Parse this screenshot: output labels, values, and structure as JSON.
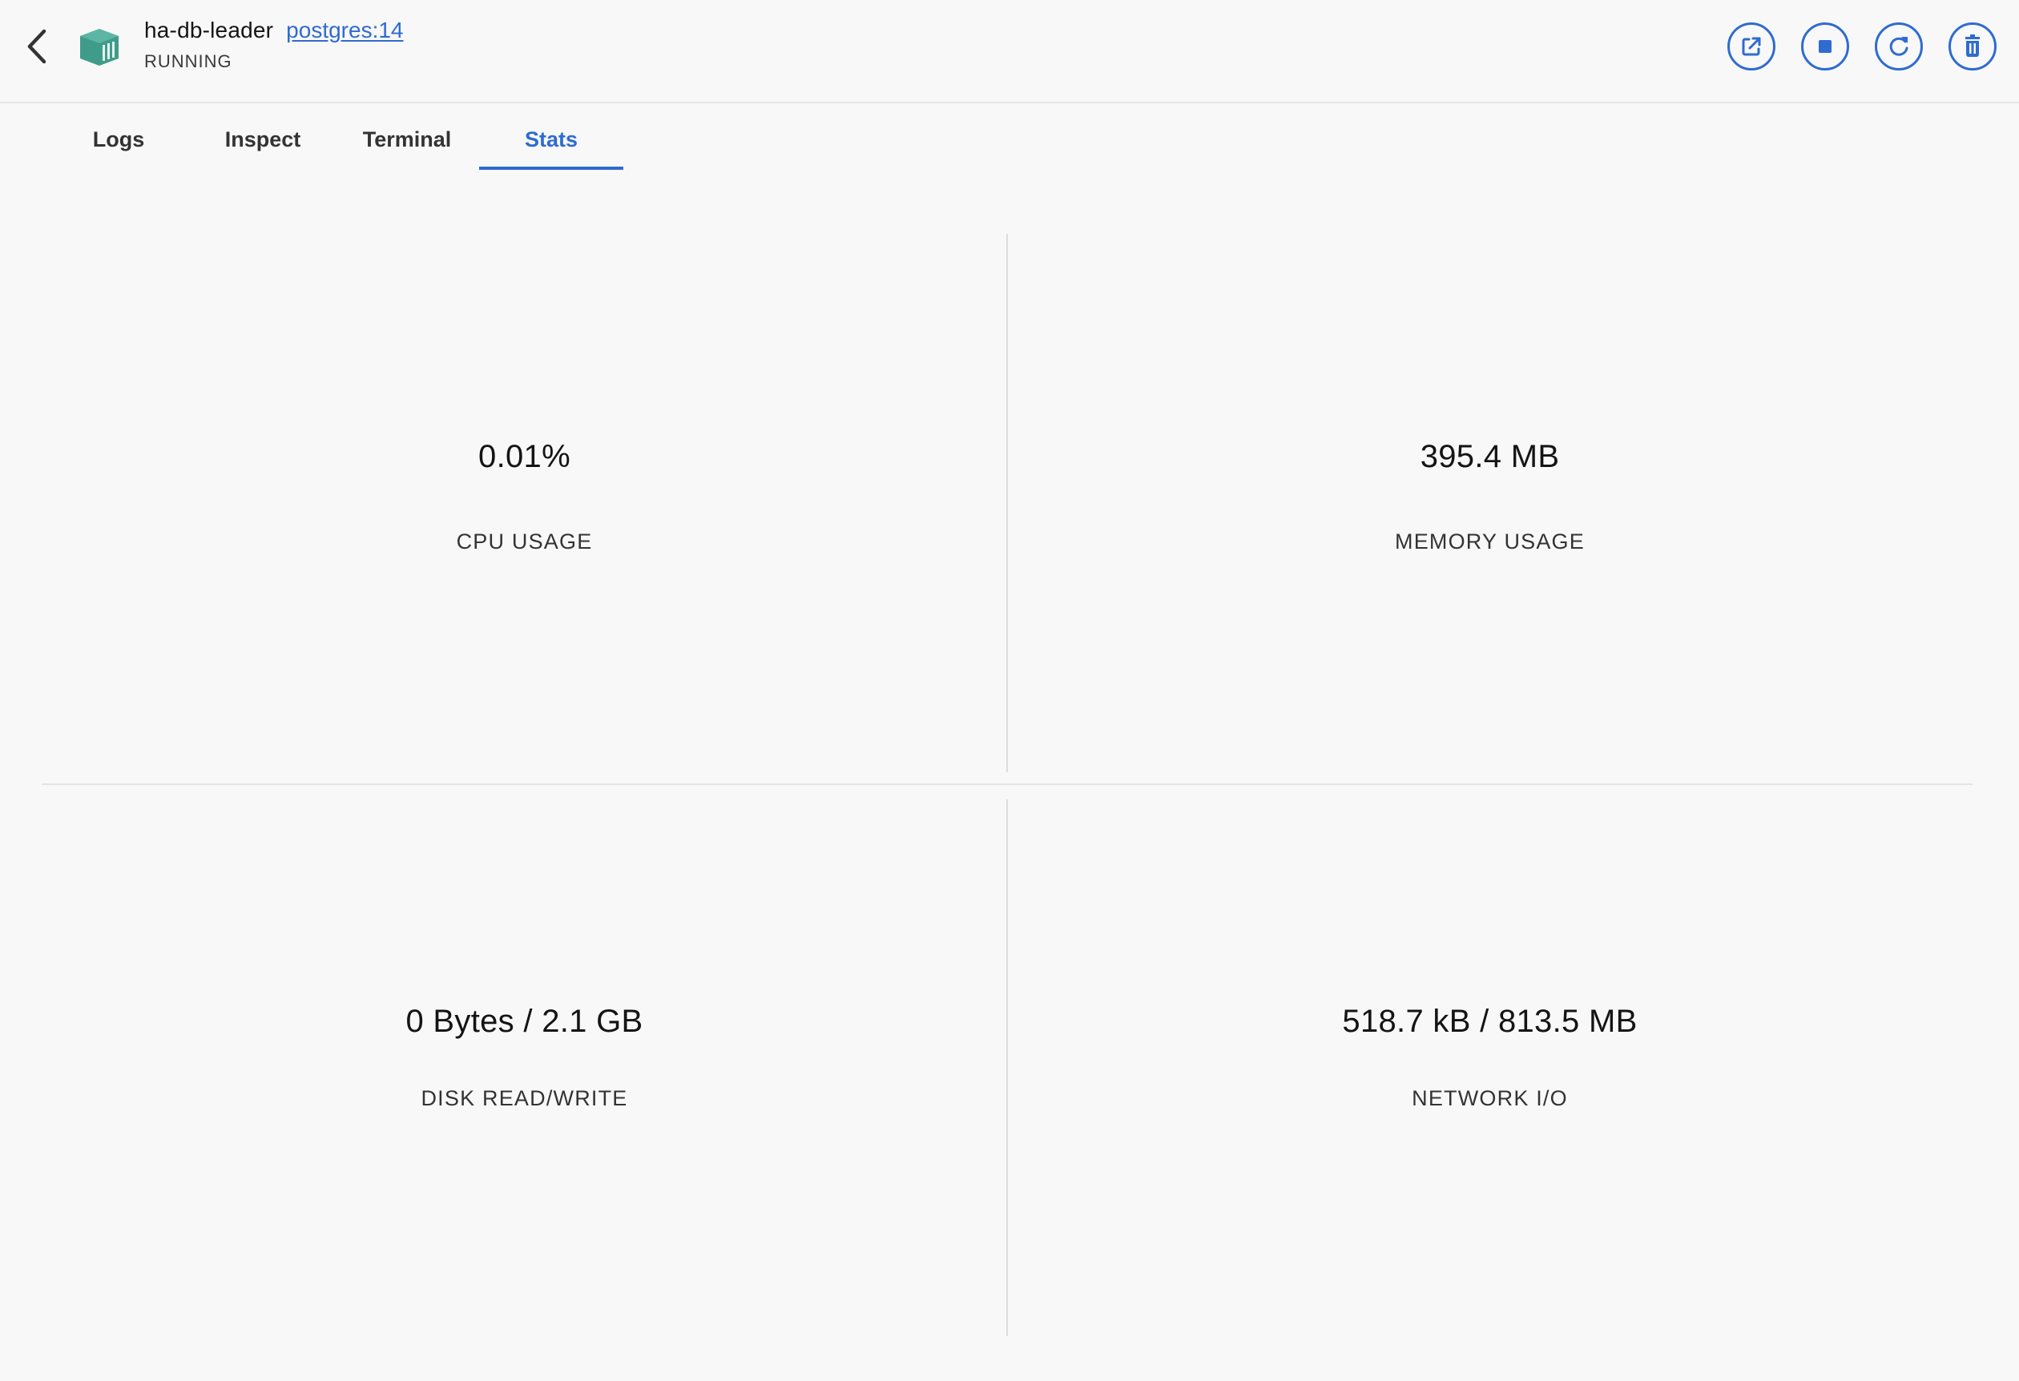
{
  "header": {
    "title": "ha-db-leader",
    "image": "postgres:14",
    "status": "RUNNING",
    "accent_color": "#2f6bd0",
    "container_icon_color": "#3f9c8a"
  },
  "actions": [
    {
      "name": "open-in-browser-icon"
    },
    {
      "name": "stop-icon"
    },
    {
      "name": "restart-icon"
    },
    {
      "name": "delete-icon"
    }
  ],
  "tabs": [
    {
      "label": "Logs",
      "active": false
    },
    {
      "label": "Inspect",
      "active": false
    },
    {
      "label": "Terminal",
      "active": false
    },
    {
      "label": "Stats",
      "active": true
    }
  ],
  "stats": {
    "cpu": {
      "value": "0.01%",
      "label": "CPU USAGE"
    },
    "memory": {
      "value": "395.4 MB",
      "label": "MEMORY USAGE"
    },
    "disk": {
      "value": "0 Bytes / 2.1 GB",
      "label": "DISK READ/WRITE"
    },
    "network": {
      "value": "518.7 kB / 813.5 MB",
      "label": "NETWORK I/O"
    }
  }
}
